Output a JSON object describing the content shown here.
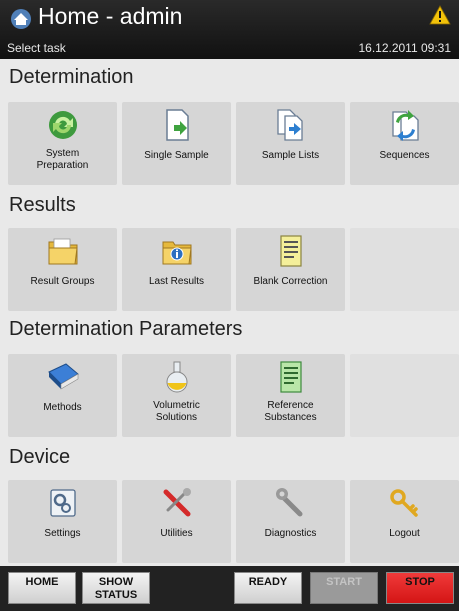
{
  "header": {
    "title": "Home - admin",
    "subtitle": "Select task",
    "datetime": "16.12.2011 09:31",
    "icons": {
      "home": "home-icon",
      "warning": "warning-icon"
    }
  },
  "sections": [
    {
      "title": "Determination",
      "tiles": [
        {
          "label": "System\nPreparation",
          "icon": "system-preparation-icon"
        },
        {
          "label": "Single Sample",
          "icon": "single-sample-icon"
        },
        {
          "label": "Sample Lists",
          "icon": "sample-lists-icon"
        },
        {
          "label": "Sequences",
          "icon": "sequences-icon"
        }
      ]
    },
    {
      "title": "Results",
      "tiles": [
        {
          "label": "Result Groups",
          "icon": "result-groups-icon"
        },
        {
          "label": "Last Results",
          "icon": "last-results-icon"
        },
        {
          "label": "Blank Correction",
          "icon": "blank-correction-icon"
        }
      ]
    },
    {
      "title": "Determination Parameters",
      "tiles": [
        {
          "label": "Methods",
          "icon": "methods-icon"
        },
        {
          "label": "Volumetric\nSolutions",
          "icon": "volumetric-solutions-icon"
        },
        {
          "label": "Reference\nSubstances",
          "icon": "reference-substances-icon"
        }
      ]
    },
    {
      "title": "Device",
      "tiles": [
        {
          "label": "Settings",
          "icon": "settings-icon"
        },
        {
          "label": "Utilities",
          "icon": "utilities-icon"
        },
        {
          "label": "Diagnostics",
          "icon": "diagnostics-icon"
        },
        {
          "label": "Logout",
          "icon": "logout-icon"
        }
      ]
    }
  ],
  "footer": {
    "home": "HOME",
    "show_status": "SHOW\nSTATUS",
    "ready": "READY",
    "start": "START",
    "stop": "STOP"
  },
  "colors": {
    "stop": "#e52222",
    "header": "#1a1a1a",
    "tile": "#d6d6d6"
  }
}
